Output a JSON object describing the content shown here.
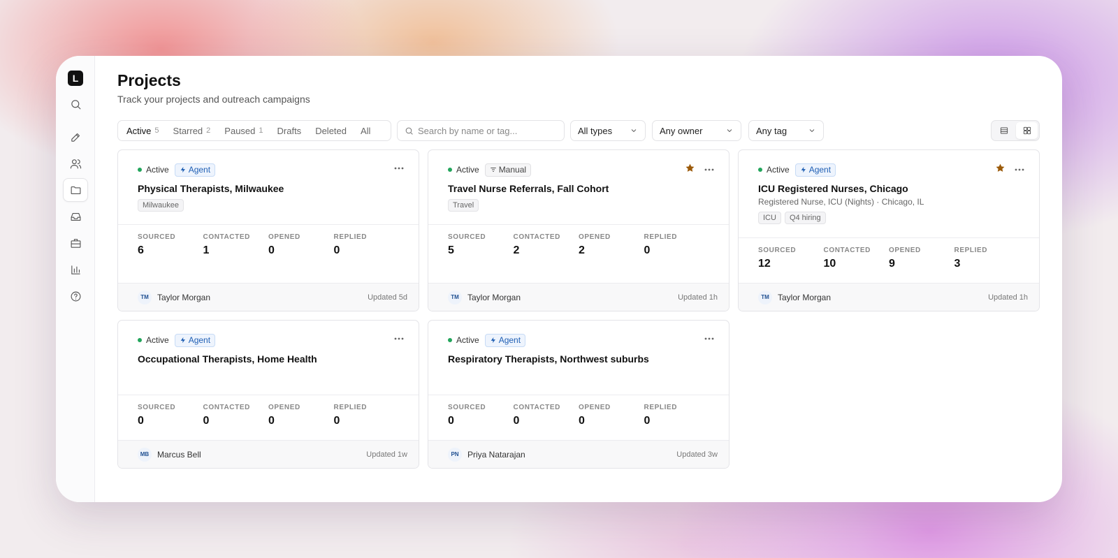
{
  "app": {
    "logo_letter": "L"
  },
  "sidebar": {
    "items": [
      {
        "name": "search",
        "icon": "search-icon"
      },
      {
        "name": "compose",
        "icon": "pencil-icon"
      },
      {
        "name": "people",
        "icon": "users-icon"
      },
      {
        "name": "projects",
        "icon": "folder-icon",
        "active": true
      },
      {
        "name": "inbox",
        "icon": "inbox-icon"
      },
      {
        "name": "jobs",
        "icon": "briefcase-icon"
      },
      {
        "name": "analytics",
        "icon": "bar-chart-icon"
      },
      {
        "name": "help",
        "icon": "help-circle-icon"
      }
    ]
  },
  "header": {
    "title": "Projects",
    "subtitle": "Track your projects and outreach campaigns"
  },
  "tabs": [
    {
      "label": "Active",
      "count": "5",
      "active": true
    },
    {
      "label": "Starred",
      "count": "2"
    },
    {
      "label": "Paused",
      "count": "1"
    },
    {
      "label": "Drafts",
      "count": ""
    },
    {
      "label": "Deleted",
      "count": ""
    },
    {
      "label": "All",
      "count": ""
    }
  ],
  "search": {
    "placeholder": "Search by name or tag...",
    "value": ""
  },
  "filters": {
    "type": "All types",
    "owner": "Any owner",
    "tag": "Any tag"
  },
  "stat_labels": {
    "sourced": "SOURCED",
    "contacted": "CONTACTED",
    "opened": "OPENED",
    "replied": "REPLIED"
  },
  "cards": [
    {
      "status": "Active",
      "type": "Agent",
      "starred": false,
      "title": "Physical Therapists, Milwaukee",
      "subtitle": "",
      "tags": [
        "Milwaukee"
      ],
      "stats": {
        "sourced": "6",
        "contacted": "1",
        "opened": "0",
        "replied": "0"
      },
      "owner_initials": "TM",
      "owner": "Taylor Morgan",
      "updated": "Updated 5d"
    },
    {
      "status": "Active",
      "type": "Manual",
      "starred": true,
      "title": "Travel Nurse Referrals, Fall Cohort",
      "subtitle": "",
      "tags": [
        "Travel"
      ],
      "stats": {
        "sourced": "5",
        "contacted": "2",
        "opened": "2",
        "replied": "0"
      },
      "owner_initials": "TM",
      "owner": "Taylor Morgan",
      "updated": "Updated 1h"
    },
    {
      "status": "Active",
      "type": "Agent",
      "starred": true,
      "title": "ICU Registered Nurses, Chicago",
      "subtitle": "Registered Nurse, ICU (Nights) · Chicago, IL",
      "tags": [
        "ICU",
        "Q4 hiring"
      ],
      "stats": {
        "sourced": "12",
        "contacted": "10",
        "opened": "9",
        "replied": "3"
      },
      "owner_initials": "TM",
      "owner": "Taylor Morgan",
      "updated": "Updated 1h"
    },
    {
      "status": "Active",
      "type": "Agent",
      "starred": false,
      "title": "Occupational Therapists, Home Health",
      "subtitle": "",
      "tags": [],
      "stats": {
        "sourced": "0",
        "contacted": "0",
        "opened": "0",
        "replied": "0"
      },
      "owner_initials": "MB",
      "owner": "Marcus Bell",
      "updated": "Updated 1w"
    },
    {
      "status": "Active",
      "type": "Agent",
      "starred": false,
      "title": "Respiratory Therapists, Northwest suburbs",
      "subtitle": "",
      "tags": [],
      "stats": {
        "sourced": "0",
        "contacted": "0",
        "opened": "0",
        "replied": "0"
      },
      "owner_initials": "PN",
      "owner": "Priya Natarajan",
      "updated": "Updated 3w"
    }
  ],
  "colors": {
    "status_active": "#22a55b",
    "agent_badge": "#1f5fb4",
    "star": "#9b5a09"
  }
}
